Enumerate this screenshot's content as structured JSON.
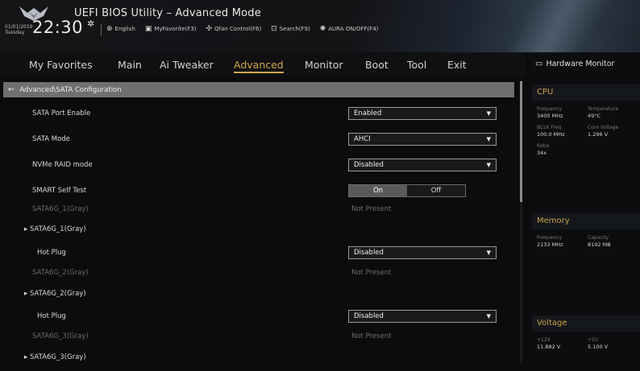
{
  "header": {
    "title": "UEFI BIOS Utility – Advanced Mode",
    "date": "01/01/2019",
    "day": "Tuesday",
    "time": "22:30",
    "links": [
      {
        "icon": "globe-icon",
        "glyph": "⊕",
        "label": "English"
      },
      {
        "icon": "favorites-icon",
        "glyph": "▣",
        "label": "MyFavorite(F3)"
      },
      {
        "icon": "fan-icon",
        "glyph": "✣",
        "label": "Qfan Control(F6)"
      },
      {
        "icon": "search-icon",
        "glyph": "⊡",
        "label": "Search(F9)"
      },
      {
        "icon": "aura-icon",
        "glyph": "✺",
        "label": "AURA ON/OFF(F4)"
      }
    ]
  },
  "tabs": [
    "My Favorites",
    "Main",
    "Ai Tweaker",
    "Advanced",
    "Monitor",
    "Boot",
    "Tool",
    "Exit"
  ],
  "active_tab": "Advanced",
  "breadcrumb": "Advanced\\SATA Configuration",
  "settings": [
    {
      "label": "SATA Port Enable",
      "type": "dropdown",
      "value": "Enabled"
    },
    {
      "label": "SATA Mode",
      "type": "dropdown",
      "value": "AHCI"
    },
    {
      "label": "NVMe RAID mode",
      "type": "dropdown",
      "value": "Disabled"
    },
    {
      "label": "SMART Self Test",
      "type": "toggle",
      "options": [
        "On",
        "Off"
      ],
      "selected": "On"
    },
    {
      "label": "SATA6G_1(Gray)",
      "type": "info",
      "value": "Not Present"
    },
    {
      "label": "SATA6G_1(Gray)",
      "type": "group"
    },
    {
      "label": "Hot Plug",
      "type": "dropdown",
      "value": "Disabled"
    },
    {
      "label": "SATA6G_2(Gray)",
      "type": "info",
      "value": "Not Present"
    },
    {
      "label": "SATA6G_2(Gray)",
      "type": "group"
    },
    {
      "label": "Hot Plug",
      "type": "dropdown",
      "value": "Disabled"
    },
    {
      "label": "SATA6G_3(Gray)",
      "type": "info",
      "value": "Not Present"
    },
    {
      "label": "SATA6G_3(Gray)",
      "type": "group"
    }
  ],
  "hardware_monitor": {
    "title": "Hardware Monitor",
    "cpu": {
      "title": "CPU",
      "frequency_label": "Frequency",
      "frequency": "3400 MHz",
      "temperature_label": "Temperature",
      "temperature": "49°C",
      "bclk_label": "BCLK Freq",
      "bclk": "100.0 MHz",
      "core_voltage_label": "Core Voltage",
      "core_voltage": "1.296 V",
      "ratio_label": "Ratio",
      "ratio": "34x"
    },
    "memory": {
      "title": "Memory",
      "frequency_label": "Frequency",
      "frequency": "2133 MHz",
      "capacity_label": "Capacity",
      "capacity": "8192 MB"
    },
    "voltage": {
      "title": "Voltage",
      "v12_label": "+12V",
      "v12": "11.882 V",
      "v5_label": "+5V",
      "v5": "5.100 V"
    }
  },
  "colors": {
    "accent": "#d1a74a",
    "breadcrumb_bg": "#6f6f6f",
    "grayed_text": "#6d6d6d"
  }
}
